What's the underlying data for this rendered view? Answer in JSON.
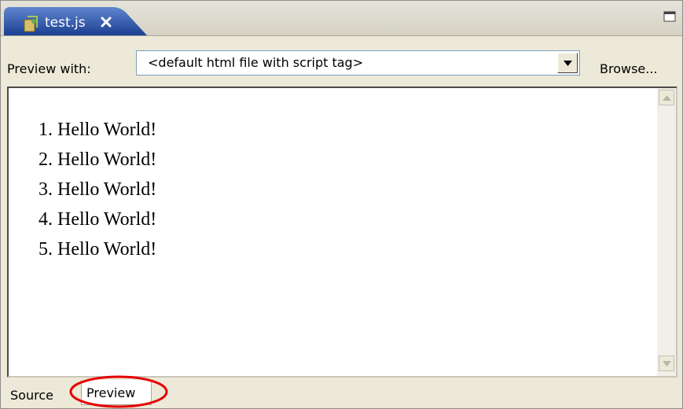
{
  "editor_tab": {
    "title": "test.js",
    "icon": "js-file-icon",
    "close_icon": "close-icon"
  },
  "window": {
    "maximize_icon": "maximize-icon"
  },
  "toolbar": {
    "preview_with_label": "Preview with:",
    "selected_file": "<default html file with script tag>",
    "dropdown_icon": "chevron-down-icon",
    "browse_label": "Browse..."
  },
  "preview": {
    "items": [
      "Hello World!",
      "Hello World!",
      "Hello World!",
      "Hello World!",
      "Hello World!"
    ],
    "numbers": [
      "1.",
      "2.",
      "3.",
      "4.",
      "5."
    ]
  },
  "bottom_tabs": {
    "source_label": "Source",
    "preview_label": "Preview",
    "active": "Preview"
  },
  "colors": {
    "active_tab": "#1e4ea6",
    "highlight_ellipse": "#e60000"
  }
}
